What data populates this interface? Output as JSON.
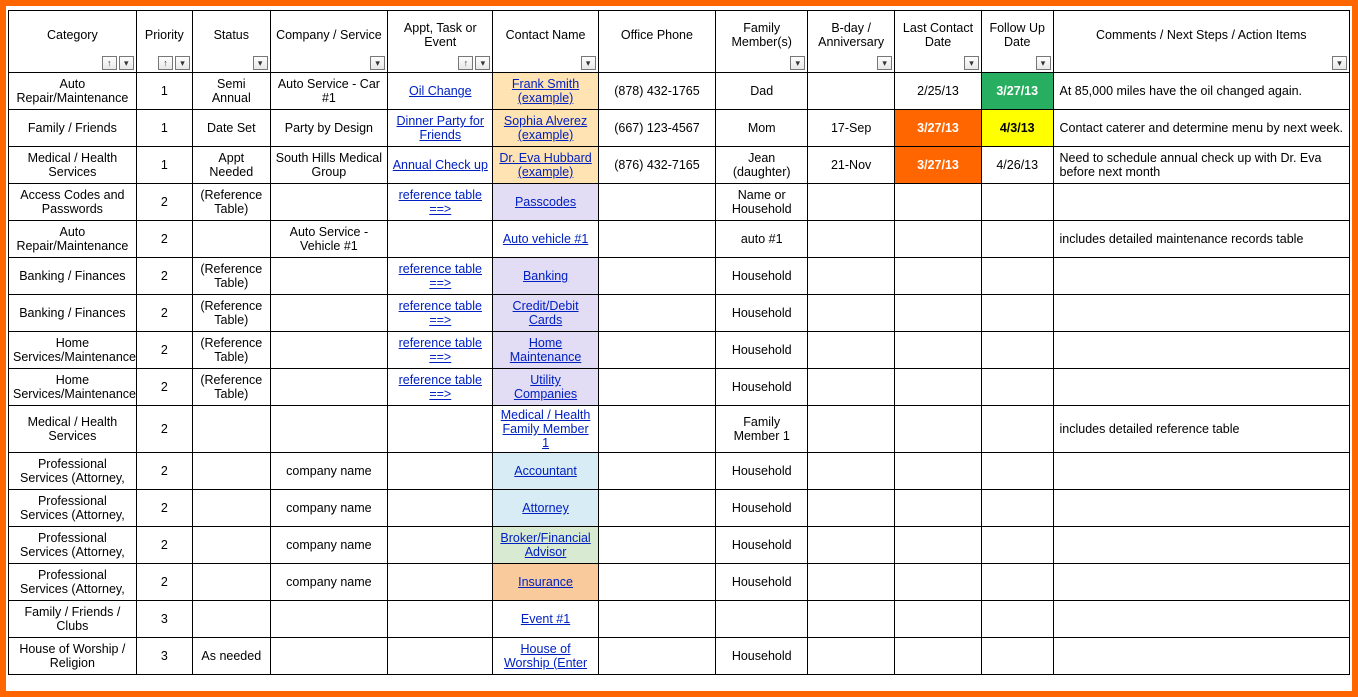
{
  "headers": [
    {
      "label": "Category",
      "sort": true,
      "filter": true
    },
    {
      "label": "Priority",
      "sort": true,
      "filter": true
    },
    {
      "label": "Status",
      "sort": false,
      "filter": true
    },
    {
      "label": "Company / Service",
      "sort": false,
      "filter": true
    },
    {
      "label": "Appt, Task or Event",
      "sort": true,
      "filter": true
    },
    {
      "label": "Contact Name",
      "sort": false,
      "filter": true
    },
    {
      "label": "Office Phone",
      "sort": false,
      "filter": false
    },
    {
      "label": "Family Member(s)",
      "sort": false,
      "filter": true
    },
    {
      "label": "B-day / Anniversary",
      "sort": false,
      "filter": true
    },
    {
      "label": "Last Contact Date",
      "sort": false,
      "filter": true
    },
    {
      "label": "Follow Up Date",
      "sort": false,
      "filter": true
    },
    {
      "label": "Comments / Next Steps / Action Items",
      "sort": false,
      "filter": true
    }
  ],
  "rows": [
    {
      "category": "Auto Repair/Maintenance",
      "priority": "1",
      "status": "Semi Annual",
      "company": "Auto Service - Car #1",
      "appt": "Oil Change",
      "apptLink": true,
      "contact": "Frank Smith (example)",
      "contactLink": true,
      "contactBg": "bg-peach",
      "phone": "(878) 432-1765",
      "family": "Dad",
      "bday": "",
      "last": "2/25/13",
      "lastBg": "",
      "follow": "3/27/13",
      "followBg": "bg-greenB",
      "comments": "At 85,000 miles have the oil changed again."
    },
    {
      "category": "Family / Friends",
      "priority": "1",
      "status": "Date Set",
      "company": "Party by Design",
      "appt": "Dinner Party for Friends",
      "apptLink": true,
      "contact": "Sophia Alverez (example)",
      "contactLink": true,
      "contactBg": "bg-peach",
      "phone": "(667) 123-4567",
      "family": "Mom",
      "bday": "17-Sep",
      "last": "3/27/13",
      "lastBg": "bg-orangeB",
      "follow": "4/3/13",
      "followBg": "bg-yellowB",
      "comments": "Contact caterer and determine menu by next week."
    },
    {
      "category": "Medical / Health Services",
      "priority": "1",
      "status": "Appt Needed",
      "company": "South Hills Medical Group",
      "appt": "Annual Check up",
      "apptLink": true,
      "contact": "Dr. Eva Hubbard (example)",
      "contactLink": true,
      "contactBg": "bg-peach",
      "phone": "(876) 432-7165",
      "family": "Jean (daughter)",
      "bday": "21-Nov",
      "last": "3/27/13",
      "lastBg": "bg-orangeB",
      "follow": "4/26/13",
      "followBg": "",
      "comments": "Need to schedule annual check up with Dr. Eva before next month"
    },
    {
      "category": "Access Codes and Passwords",
      "priority": "2",
      "status": "(Reference Table)",
      "company": "",
      "appt": "reference table ==>",
      "apptLink": true,
      "contact": "Passcodes ",
      "contactLink": true,
      "contactBg": "bg-lav",
      "phone": "",
      "family": "Name or Household",
      "bday": "",
      "last": "",
      "lastBg": "",
      "follow": "",
      "followBg": "",
      "comments": ""
    },
    {
      "category": "Auto Repair/Maintenance",
      "priority": "2",
      "status": "",
      "company": "Auto Service - Vehicle #1",
      "appt": "",
      "apptLink": false,
      "contact": "Auto vehicle #1",
      "contactLink": true,
      "contactBg": "",
      "phone": "",
      "family": "auto #1",
      "bday": "",
      "last": "",
      "lastBg": "",
      "follow": "",
      "followBg": "",
      "comments": "includes detailed maintenance records table"
    },
    {
      "category": "Banking / Finances",
      "priority": "2",
      "status": "(Reference Table)",
      "company": "",
      "appt": "reference table ==>",
      "apptLink": true,
      "contact": "Banking ",
      "contactLink": true,
      "contactBg": "bg-lav",
      "phone": "",
      "family": "Household",
      "bday": "",
      "last": "",
      "lastBg": "",
      "follow": "",
      "followBg": "",
      "comments": ""
    },
    {
      "category": "Banking / Finances",
      "priority": "2",
      "status": "(Reference Table)",
      "company": "",
      "appt": "reference table ==>",
      "apptLink": true,
      "contact": "Credit/Debit Cards ",
      "contactLink": true,
      "contactBg": "bg-lav",
      "phone": "",
      "family": "Household",
      "bday": "",
      "last": "",
      "lastBg": "",
      "follow": "",
      "followBg": "",
      "comments": ""
    },
    {
      "category": "Home Services/Maintenance",
      "priority": "2",
      "status": "(Reference Table)",
      "company": "",
      "appt": "reference table ==>",
      "apptLink": true,
      "contact": "Home Maintenance ",
      "contactLink": true,
      "contactBg": "bg-lav",
      "phone": "",
      "family": "Household",
      "bday": "",
      "last": "",
      "lastBg": "",
      "follow": "",
      "followBg": "",
      "comments": ""
    },
    {
      "category": "Home Services/Maintenance",
      "priority": "2",
      "status": "(Reference Table)",
      "company": "",
      "appt": "reference table ==>",
      "apptLink": true,
      "contact": "Utility Companies",
      "contactLink": true,
      "contactBg": "bg-lav",
      "phone": "",
      "family": "Household",
      "bday": "",
      "last": "",
      "lastBg": "",
      "follow": "",
      "followBg": "",
      "comments": ""
    },
    {
      "category": "Medical / Health Services",
      "priority": "2",
      "status": "",
      "company": "",
      "appt": "",
      "apptLink": false,
      "contact": "Medical / Health Family Member 1",
      "contactLink": true,
      "contactBg": "",
      "phone": "",
      "family": "Family Member 1",
      "bday": "",
      "last": "",
      "lastBg": "",
      "follow": "",
      "followBg": "",
      "comments": "includes detailed reference table"
    },
    {
      "category": "Professional Services (Attorney,",
      "priority": "2",
      "status": "",
      "company": "company name",
      "appt": "",
      "apptLink": false,
      "contact": "Accountant ",
      "contactLink": true,
      "contactBg": "bg-blue",
      "phone": "",
      "family": "Household",
      "bday": "",
      "last": "",
      "lastBg": "",
      "follow": "",
      "followBg": "",
      "comments": ""
    },
    {
      "category": "Professional Services (Attorney,",
      "priority": "2",
      "status": "",
      "company": "company name",
      "appt": "",
      "apptLink": false,
      "contact": "Attorney ",
      "contactLink": true,
      "contactBg": "bg-blue",
      "phone": "",
      "family": "Household",
      "bday": "",
      "last": "",
      "lastBg": "",
      "follow": "",
      "followBg": "",
      "comments": ""
    },
    {
      "category": "Professional Services (Attorney,",
      "priority": "2",
      "status": "",
      "company": "company name",
      "appt": "",
      "apptLink": false,
      "contact": "Broker/Financial Advisor ",
      "contactLink": true,
      "contactBg": "bg-green",
      "phone": "",
      "family": "Household",
      "bday": "",
      "last": "",
      "lastBg": "",
      "follow": "",
      "followBg": "",
      "comments": ""
    },
    {
      "category": "Professional Services (Attorney,",
      "priority": "2",
      "status": "",
      "company": "company name",
      "appt": "",
      "apptLink": false,
      "contact": "Insurance ",
      "contactLink": true,
      "contactBg": "bg-orangec",
      "phone": "",
      "family": "Household",
      "bday": "",
      "last": "",
      "lastBg": "",
      "follow": "",
      "followBg": "",
      "comments": ""
    },
    {
      "category": "Family / Friends / Clubs",
      "priority": "3",
      "status": "",
      "company": "",
      "appt": "",
      "apptLink": false,
      "contact": "Event #1 ",
      "contactLink": true,
      "contactBg": "",
      "phone": "",
      "family": "",
      "bday": "",
      "last": "",
      "lastBg": "",
      "follow": "",
      "followBg": "",
      "comments": ""
    },
    {
      "category": "House of Worship / Religion",
      "priority": "3",
      "status": "As needed",
      "company": "",
      "appt": "",
      "apptLink": false,
      "contact": "House of Worship (Enter",
      "contactLink": true,
      "contactBg": "",
      "phone": "",
      "family": "Household",
      "bday": "",
      "last": "",
      "lastBg": "",
      "follow": "",
      "followBg": "",
      "comments": ""
    }
  ]
}
